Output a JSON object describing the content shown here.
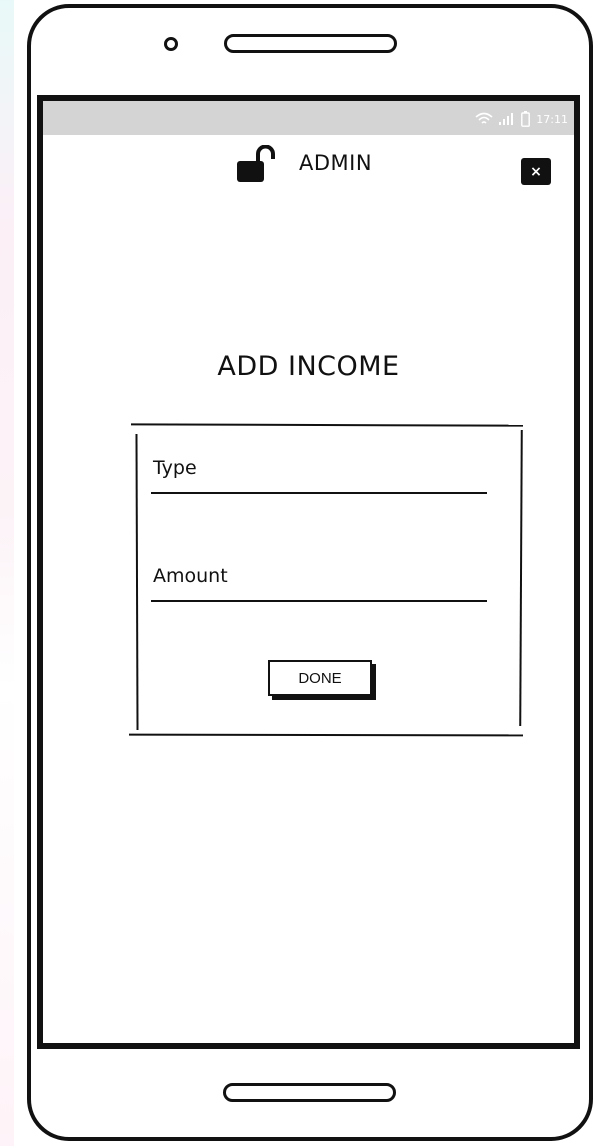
{
  "status_bar": {
    "time": "17:11",
    "icons": [
      "wifi-icon",
      "signal-icon",
      "battery-icon"
    ]
  },
  "header": {
    "title": "ADMIN",
    "lock_icon": "unlocked-lock-icon",
    "close_label": "×"
  },
  "form": {
    "title": "ADD INCOME",
    "fields": [
      {
        "label": "Type",
        "value": ""
      },
      {
        "label": "Amount",
        "value": ""
      }
    ],
    "submit_label": "DONE"
  },
  "colors": {
    "ink": "#111111",
    "status_bar": "#d4d4d4",
    "background": "#ffffff"
  }
}
